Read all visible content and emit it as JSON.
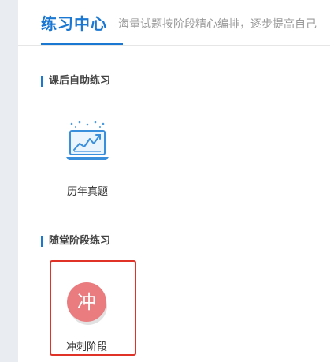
{
  "header": {
    "title": "练习中心",
    "subtitle": "海量试题按阶段精心编排，逐步提高自己"
  },
  "sections": [
    {
      "title": "课后自助练习",
      "cards": [
        {
          "label": "历年真题",
          "icon": "chart-screen-icon"
        }
      ]
    },
    {
      "title": "随堂阶段练习",
      "cards": [
        {
          "label": "冲刺阶段",
          "badge": "冲",
          "badge_color": "#ea7c7f",
          "selected_border_color": "#e03226"
        }
      ]
    }
  ],
  "colors": {
    "accent": "#1a77d2",
    "page_background": "#e9ecf0"
  }
}
